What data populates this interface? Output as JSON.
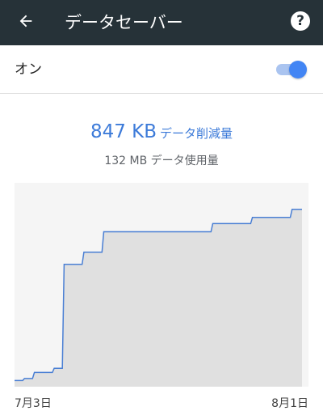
{
  "toolbar": {
    "title": "データセーバー",
    "back_icon": "arrow-back-icon",
    "help_icon": "help-icon",
    "help_glyph": "?",
    "background": "#263238"
  },
  "toggle": {
    "label": "オン",
    "state": "on",
    "accent": "#4285f4"
  },
  "stats": {
    "saved_value": "847 KB",
    "saved_label": "データ削減量",
    "used_text": "132 MB データ使用量",
    "saved_color": "#3d7bd9"
  },
  "chart_data": {
    "type": "area",
    "x_start_label": "7月3日",
    "x_end_label": "8月1日",
    "x": [
      1,
      2,
      3,
      4,
      5,
      6,
      7,
      8,
      9,
      10,
      11,
      12,
      13,
      14,
      15,
      16,
      17,
      18,
      19,
      20,
      21,
      22,
      23,
      24,
      25,
      26,
      27,
      28,
      29,
      30
    ],
    "values": [
      3,
      4,
      7,
      7,
      9,
      60,
      60,
      66,
      66,
      76,
      76,
      76,
      76,
      76,
      76,
      76,
      76,
      76,
      76,
      76,
      80,
      80,
      80,
      80,
      83,
      83,
      83,
      83,
      87,
      87
    ],
    "ylim": [
      0,
      100
    ],
    "line_color": "#4a7fd4",
    "fill_color": "#e0e0e0",
    "grid": false
  }
}
